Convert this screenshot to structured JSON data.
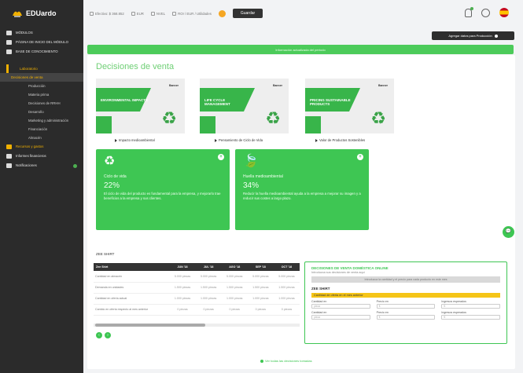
{
  "brand": {
    "logo_text": "EDUardo"
  },
  "sidebar": {
    "items": [
      {
        "label": "MÓDULOS",
        "icon": "home-icon"
      },
      {
        "label": "PÁGINA DE INICIO DEL MÓDULO",
        "icon": "list-icon"
      },
      {
        "label": "BASE DE CONOCIMIENTO",
        "icon": "book-icon"
      }
    ],
    "section": "Laboratorio",
    "section_active": "Decisiones de venta",
    "subs": [
      "Producción",
      "Materia prima",
      "Decisiones de RRHH",
      "Desarrollo",
      "Marketing y administración",
      "Financiación",
      "Almacén"
    ],
    "extra": "Recursos y gastos",
    "reports": "Informes financieros",
    "notifications": "Notificaciones"
  },
  "topbar": {
    "items": [
      "Efectivo: $ 368.852",
      "EUR",
      "NVEL",
      "ROI / EUR / Utilidades"
    ],
    "save_label": "Guardar"
  },
  "actions": {
    "dark_button": "Agregar datos para Producción"
  },
  "banner": {
    "text": "Información actualizada del período"
  },
  "page": {
    "title": "Decisiones de venta"
  },
  "image_cards": [
    {
      "overlay": "ENVIRONMENTAL IMPACTS",
      "brand": "Banner",
      "caption": "Impacto medioambiental"
    },
    {
      "overlay": "LIFE CYCLE MANAGEMENT",
      "brand": "Banner",
      "caption": "Pensamiento de Ciclo de Vida"
    },
    {
      "overlay": "PRICING SUSTAINABLE PRODUCTS",
      "brand": "Banner",
      "caption": "Valor de Productos Sostenibles"
    }
  ],
  "green_cards": [
    {
      "title": "Ciclo de vida",
      "pct": "22%",
      "desc": "El ciclo de vida del producto es fundamental para la empresa, y mejorarlo trae beneficios a la empresa y sus clientes."
    },
    {
      "title": "Huella medioambiental",
      "pct": "34%",
      "desc": "Reducir la huella medioambiental ayuda a la empresa a mejorar su imagen y a reducir sus costes a largo plazo."
    }
  ],
  "table": {
    "label": "ZEE SHIRT",
    "headers": [
      "Zee Shirt",
      "JUN '18",
      "JUL '18",
      "AGO '18",
      "SEP '18",
      "OCT '18"
    ],
    "rows": [
      [
        "Cantidad en almacén",
        "5.000 piezas",
        "5.000 piezas",
        "5.000 piezas",
        "5.000 piezas",
        "5.000 piezas"
      ],
      [
        "Demanda en unidades",
        "1.500 piezas",
        "1.500 piezas",
        "1.500 piezas",
        "1.500 piezas",
        "1.500 piezas"
      ],
      [
        "Cantidad en oferta actual",
        "1.000 piezas",
        "1.000 piezas",
        "1.000 piezas",
        "1.000 piezas",
        "1.000 piezas"
      ],
      [
        "Cambio en oferta respecto al mes anterior",
        "0 piezas",
        "0 piezas",
        "0 piezas",
        "0 piezas",
        "0 piezas"
      ]
    ]
  },
  "decisions": {
    "title": "DECISIONES DE VENTA DOMÉSTICA ONLINE",
    "subtitle": "Introduzca sus decisiones de venta aquí",
    "gray_note": "Introduzca la cantidad y el precio para cada producto en este mes",
    "product": "ZEE SHIRT",
    "yellow_note": "Cantidad de oferta en el mes anterior",
    "row1": {
      "f1": "Cantidad en",
      "f2": "Precio en",
      "f3": "Ingresos esperados"
    },
    "row2": {
      "f1": "Cantidad en",
      "f2": "Precio en",
      "f3": "Ingresos esperados"
    },
    "placeholders": {
      "unit": "pieza",
      "currency": "€"
    }
  },
  "footer": {
    "link": "Ver todas las decisiones tomadas"
  },
  "colors": {
    "green": "#3ec653",
    "dark": "#2b2b2b",
    "gold": "#f0b000"
  }
}
